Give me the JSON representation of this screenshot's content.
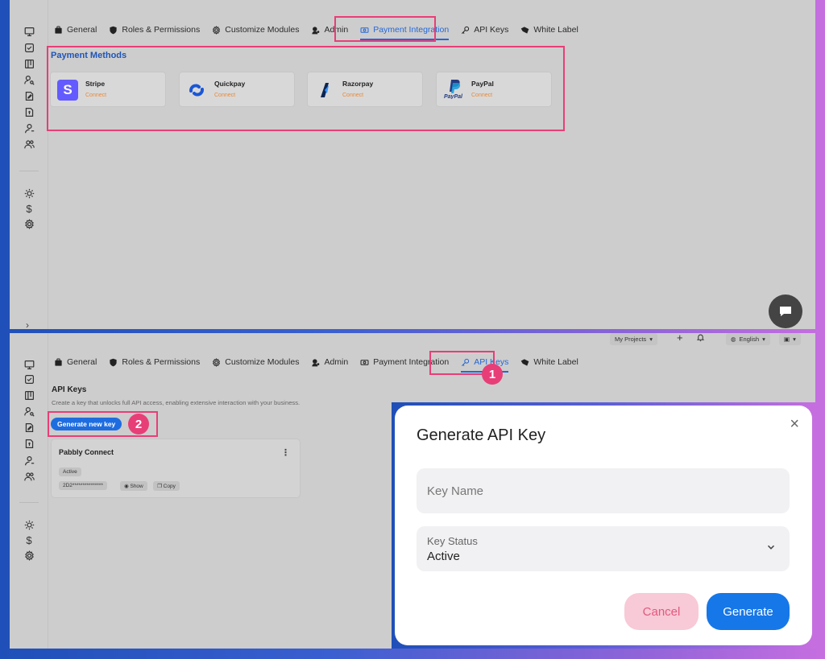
{
  "tabs": [
    {
      "label": "General",
      "icon": "briefcase-icon"
    },
    {
      "label": "Roles & Permissions",
      "icon": "shield-icon"
    },
    {
      "label": "Customize Modules",
      "icon": "gear-icon"
    },
    {
      "label": "Admin",
      "icon": "admin-icon"
    },
    {
      "label": "Payment Integration",
      "icon": "money-icon"
    },
    {
      "label": "API Keys",
      "icon": "key-icon"
    },
    {
      "label": "White Label",
      "icon": "tag-icon"
    }
  ],
  "top": {
    "active_tab": "Payment Integration",
    "payment_methods_title": "Payment Methods",
    "methods": [
      {
        "name": "Stripe",
        "action": "Connect"
      },
      {
        "name": "Quickpay",
        "action": "Connect"
      },
      {
        "name": "Razorpay",
        "action": "Connect"
      },
      {
        "name": "PayPal",
        "action": "Connect"
      }
    ]
  },
  "bottom": {
    "active_tab": "API Keys",
    "header": {
      "projects": "My Projects",
      "language": "English"
    },
    "title": "API Keys",
    "description": "Create a key that unlocks full API access, enabling extensive interaction with your business.",
    "generate_button": "Generate new key",
    "step1": "1",
    "step2": "2",
    "key_card": {
      "name": "Pabbly Connect",
      "status": "Active",
      "masked_key": "2D2***************",
      "show": "Show",
      "copy": "Copy"
    }
  },
  "modal": {
    "title": "Generate API Key",
    "close": "×",
    "key_name_placeholder": "Key Name",
    "key_status_label": "Key Status",
    "key_status_value": "Active",
    "cancel": "Cancel",
    "generate": "Generate"
  },
  "colors": {
    "accent": "#2468d6",
    "highlight": "#e83e77",
    "connect": "#e88a3a",
    "generate_button": "#1677e8"
  }
}
